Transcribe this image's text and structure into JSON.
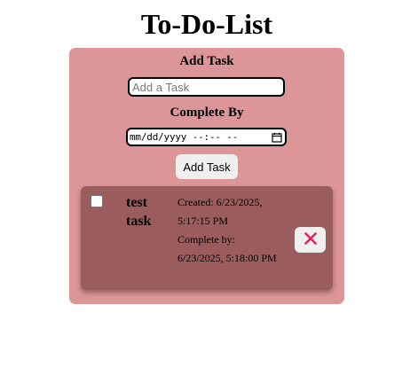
{
  "header": {
    "title": "To-Do-List"
  },
  "form": {
    "add_task_label": "Add Task",
    "task_input": {
      "placeholder": "Add a Task",
      "value": ""
    },
    "complete_by_label": "Complete By",
    "complete_by_input": {
      "display": "mm/dd/yyyy --:-- --",
      "icon": "calendar-icon"
    },
    "add_button_label": "Add Task"
  },
  "tasks": [
    {
      "name": "test task",
      "completed": false,
      "created": "Created: 6/23/2025, 5:17:15 PM",
      "complete_by": "Complete by: 6/23/2025, 5:18:00 PM",
      "delete_icon": "close-icon"
    }
  ],
  "colors": {
    "panel_bg": "#dd9697",
    "card_bg": "#9a5c5c",
    "delete_icon": "#e0245e"
  }
}
